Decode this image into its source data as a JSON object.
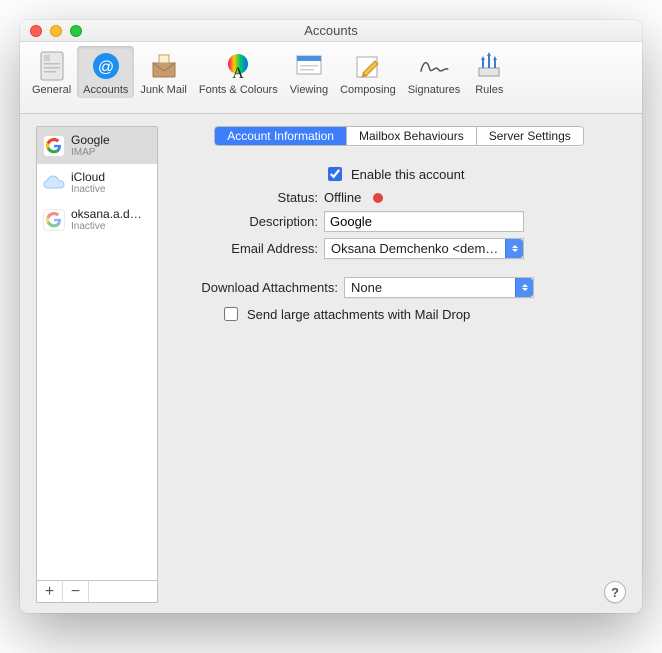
{
  "window": {
    "title": "Accounts"
  },
  "toolbar": {
    "items": [
      {
        "label": "General"
      },
      {
        "label": "Accounts"
      },
      {
        "label": "Junk Mail"
      },
      {
        "label": "Fonts & Colours"
      },
      {
        "label": "Viewing"
      },
      {
        "label": "Composing"
      },
      {
        "label": "Signatures"
      },
      {
        "label": "Rules"
      }
    ]
  },
  "sidebar": {
    "accounts": [
      {
        "name": "Google",
        "sub": "IMAP"
      },
      {
        "name": "iCloud",
        "sub": "Inactive"
      },
      {
        "name": "oksana.a.d…",
        "sub": "Inactive"
      }
    ],
    "add": "+",
    "remove": "−"
  },
  "tabs": {
    "t0": "Account Information",
    "t1": "Mailbox Behaviours",
    "t2": "Server Settings"
  },
  "form": {
    "enable_label": "Enable this account",
    "enable_checked": true,
    "status_label": "Status:",
    "status_value": "Offline",
    "description_label": "Description:",
    "description_value": "Google",
    "email_label": "Email Address:",
    "email_value": "Oksana Demchenko <demchen…",
    "download_label": "Download Attachments:",
    "download_value": "None",
    "maildrop_label": "Send large attachments with Mail Drop",
    "maildrop_checked": false
  },
  "help": "?"
}
